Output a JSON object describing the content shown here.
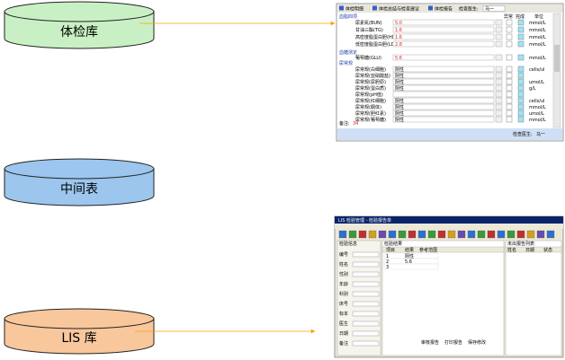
{
  "databases": {
    "exam_db": {
      "label": "体检库",
      "fill": "#c9f0c4"
    },
    "middle_table": {
      "label": "中间表",
      "fill": "#9cc6ee"
    },
    "lis_db": {
      "label": "LIS 库",
      "fill": "#f9c79c"
    }
  },
  "arrow_color": "#f7a300",
  "exam_screenshot": {
    "tabs": [
      "体检明细",
      "体检总结与检查建议",
      "体检报告"
    ],
    "result_label": "检查医生:",
    "result_value": "马一",
    "columns": [
      "异常",
      "完成",
      "单位"
    ],
    "section_1": "血脂四项",
    "rows_1": [
      {
        "name": "尿素氮(BUN)",
        "value": "5.0",
        "unit": "mmol/L"
      },
      {
        "name": "甘油三酯(TG)",
        "value": "1.6",
        "unit": "mmol/L"
      },
      {
        "name": "高密度脂蛋白胆(HDL-C)",
        "value": "1.6",
        "unit": "mmol/L"
      },
      {
        "name": "低密度脂蛋白胆(LDL-C)",
        "value": "2.8",
        "unit": "mmol/L"
      }
    ],
    "section_2": "血糖测定",
    "rows_2": [
      {
        "name": "葡萄糖(GLU)",
        "value": "5.6",
        "unit": "mmol/L"
      }
    ],
    "section_3": "尿常规",
    "rows_3": [
      {
        "name": "尿常规(白细胞)",
        "value": "阴性",
        "unit": "cells/ul"
      },
      {
        "name": "尿常规(亚硝酸盐)",
        "value": "阴性",
        "unit": ""
      },
      {
        "name": "尿常规(尿胆原)",
        "value": "阴性",
        "unit": "umol/L"
      },
      {
        "name": "尿常规(蛋白质)",
        "value": "阴性",
        "unit": "g/L"
      },
      {
        "name": "尿常规(pH值)",
        "value": "",
        "unit": ""
      },
      {
        "name": "尿常规(红细胞)",
        "value": "阴性",
        "unit": "cells/ul"
      },
      {
        "name": "尿常规(酮体)",
        "value": "阴性",
        "unit": "mmol/L"
      },
      {
        "name": "尿常规(胆红素)",
        "value": "阴性",
        "unit": "umol/L"
      },
      {
        "name": "尿常规(葡萄糖)",
        "value": "阴性",
        "unit": "mmol/L"
      }
    ],
    "footer_label": "备注:",
    "footer_value": "34",
    "status_label": "检查医生:",
    "status_value": "马一"
  },
  "lis_screenshot": {
    "title": "LIS 检验管理 - 检验报告单",
    "panel_left_title": "检验信息",
    "panel_middle_title": "检验结果",
    "panel_right_title": "未出报告列表",
    "grid_headers": [
      "项目",
      "结果",
      "参考范围"
    ],
    "grid_rows": [
      {
        "item": "1",
        "result": "阴性",
        "ref": ""
      },
      {
        "item": "2",
        "result": "5.6",
        "ref": ""
      },
      {
        "item": "3",
        "result": "",
        "ref": ""
      }
    ],
    "right_headers": [
      "姓名",
      "日期",
      "状态"
    ],
    "form_labels": [
      "编号",
      "姓名",
      "性别",
      "年龄",
      "科别",
      "床号",
      "标本",
      "医生",
      "日期",
      "备注"
    ],
    "bottom_buttons": [
      "审核报告",
      "打印报告",
      "保存修改"
    ]
  }
}
